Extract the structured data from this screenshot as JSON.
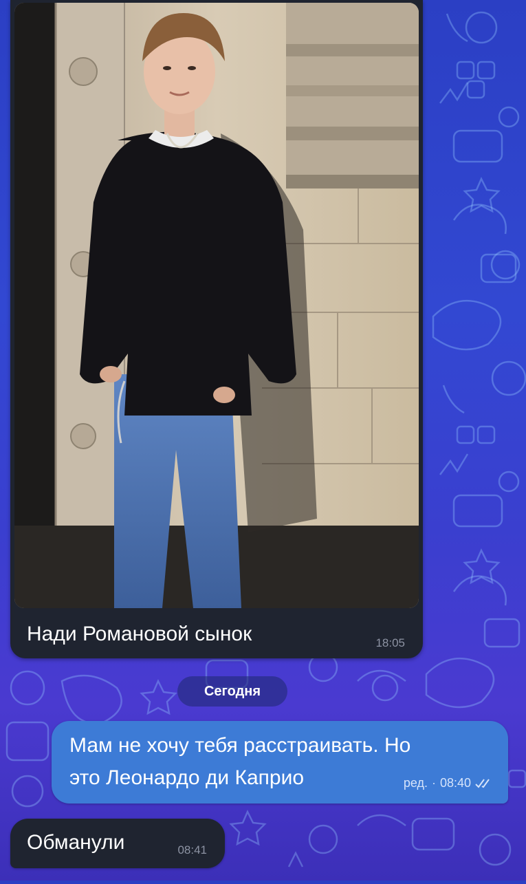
{
  "chat": {
    "messages": [
      {
        "type": "photo",
        "caption": "Нади Романовой сынок",
        "time": "18:05"
      },
      {
        "type": "outgoing",
        "line1": "Мам не хочу тебя расстраивать. Но",
        "line2": "это Леонардо ди Каприо",
        "edited": "ред.",
        "separator": "·",
        "time": "08:40",
        "status_icon": "double-check-icon"
      },
      {
        "type": "incoming",
        "text": "Обманули",
        "time": "08:41"
      }
    ],
    "date_separator": "Сегодня"
  },
  "colors": {
    "outgoing_bubble": "#3d7bd6",
    "incoming_bubble": "#1f2430",
    "background": "#3248d2"
  }
}
